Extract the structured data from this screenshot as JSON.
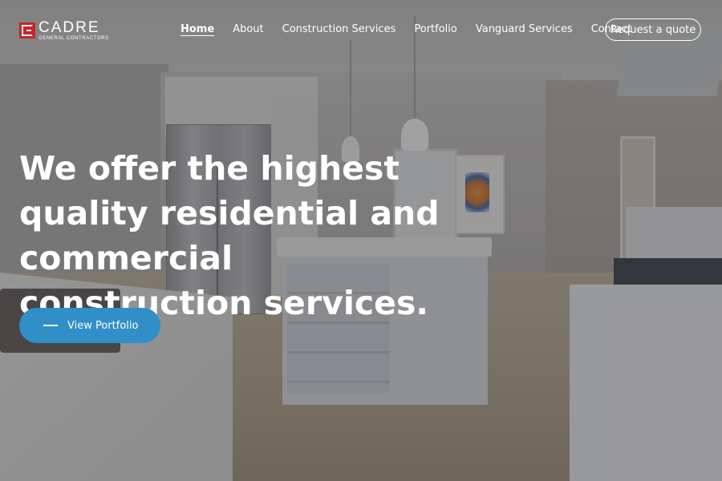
{
  "brand": {
    "name": "CADRE",
    "tagline": "GENERAL CONTRACTORS"
  },
  "nav": {
    "items": [
      {
        "label": "Home",
        "active": true
      },
      {
        "label": "About",
        "active": false
      },
      {
        "label": "Construction Services",
        "active": false
      },
      {
        "label": "Portfolio",
        "active": false
      },
      {
        "label": "Vanguard Services",
        "active": false
      },
      {
        "label": "Contact",
        "active": false
      }
    ],
    "cta_label": "Request a quote"
  },
  "hero": {
    "heading": "We offer the highest quality residential and commercial construction services.",
    "button_label": "View Portfolio"
  },
  "colors": {
    "brand_red": "#c7262c",
    "accent_blue": "#2f8fc6"
  },
  "icons": {
    "logo": "cadre-logo-icon",
    "button_dash": "dash-icon"
  }
}
